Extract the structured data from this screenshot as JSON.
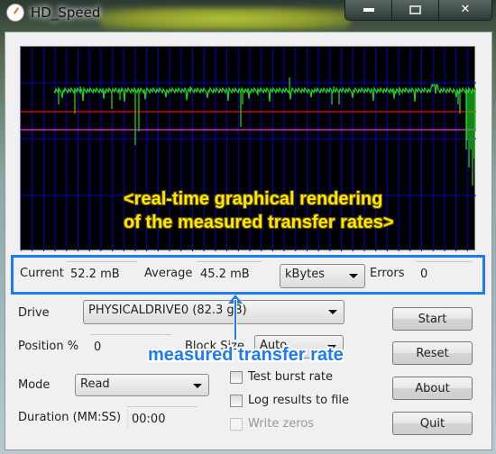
{
  "window": {
    "title": "HD_Speed",
    "minimize": "minimize",
    "maximize": "maximize",
    "close": "✕"
  },
  "graph": {
    "grid_color": "#0000cc",
    "trace_color": "#22cc22",
    "average_line_color": "#cc0000",
    "marker_line_color": "#cc22cc",
    "annotation_line1": "<real-time graphical rendering",
    "annotation_line2": "of the measured transfer rates>"
  },
  "stats": {
    "current_label": "Current",
    "current_value": "52.2 mB",
    "average_label": "Average",
    "average_value": "45.2 mB",
    "unit_select": "kBytes",
    "errors_label": "Errors",
    "errors_value": "0"
  },
  "form": {
    "drive_label": "Drive",
    "drive_value": "PHYSICALDRIVE0 (82.3 gB)",
    "position_label": "Position %",
    "position_value": "0",
    "block_size_label": "Block Size",
    "block_size_value": "Auto",
    "mode_label": "Mode",
    "mode_value": "Read",
    "duration_label": "Duration (MM:SS)",
    "duration_value": "00:00"
  },
  "checkboxes": [
    {
      "label": "Test burst rate",
      "checked": false,
      "enabled": true
    },
    {
      "label": "Log results to file",
      "checked": false,
      "enabled": true
    },
    {
      "label": "Write zeros",
      "checked": false,
      "enabled": false
    }
  ],
  "buttons": {
    "start": "Start",
    "reset": "Reset",
    "about": "About",
    "quit": "Quit"
  },
  "annotation": {
    "stats_callout": "measured transfer rate",
    "accent": "#1e7bf0"
  }
}
